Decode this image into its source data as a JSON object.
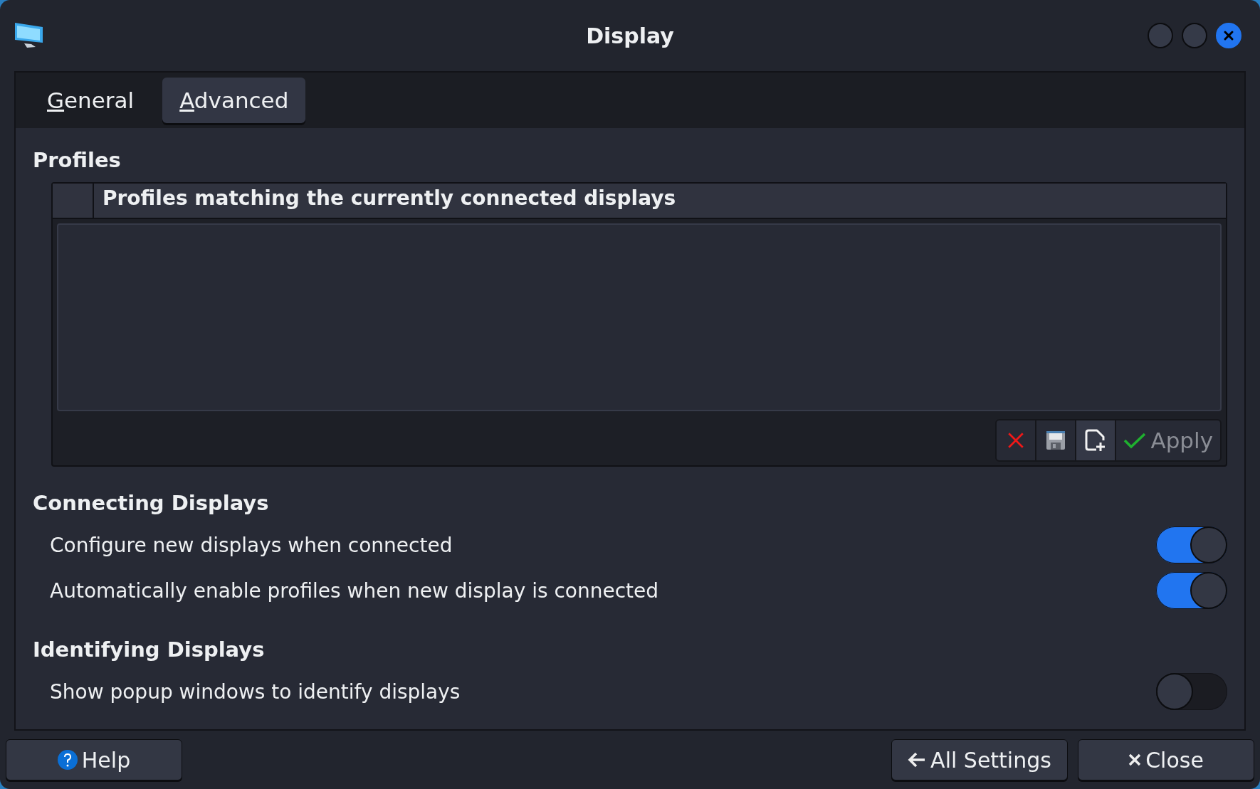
{
  "window": {
    "title": "Display"
  },
  "tabs": [
    {
      "label": "General",
      "selected": false
    },
    {
      "label": "Advanced",
      "selected": true
    }
  ],
  "profiles": {
    "heading": "Profiles",
    "table_header": "Profiles matching the currently connected displays",
    "toolbar": [
      {
        "kind": "delete",
        "disabled": false,
        "highlighted": false
      },
      {
        "kind": "save",
        "disabled": true,
        "highlighted": false
      },
      {
        "kind": "new",
        "disabled": false,
        "highlighted": true
      },
      {
        "kind": "apply",
        "label": "Apply",
        "disabled": true,
        "highlighted": false
      }
    ]
  },
  "sections": [
    {
      "heading": "Connecting Displays",
      "options": [
        {
          "label": "Configure new displays when connected",
          "on": true
        },
        {
          "label": "Automatically enable profiles when new display is connected",
          "on": true
        }
      ]
    },
    {
      "heading": "Identifying Displays",
      "options": [
        {
          "label": "Show popup windows to identify displays",
          "on": false
        }
      ]
    }
  ],
  "footer": {
    "left": [
      {
        "kind": "help",
        "label": "Help"
      }
    ],
    "right": [
      {
        "kind": "back",
        "label": "All Settings"
      },
      {
        "kind": "close",
        "label": "Close"
      }
    ]
  }
}
